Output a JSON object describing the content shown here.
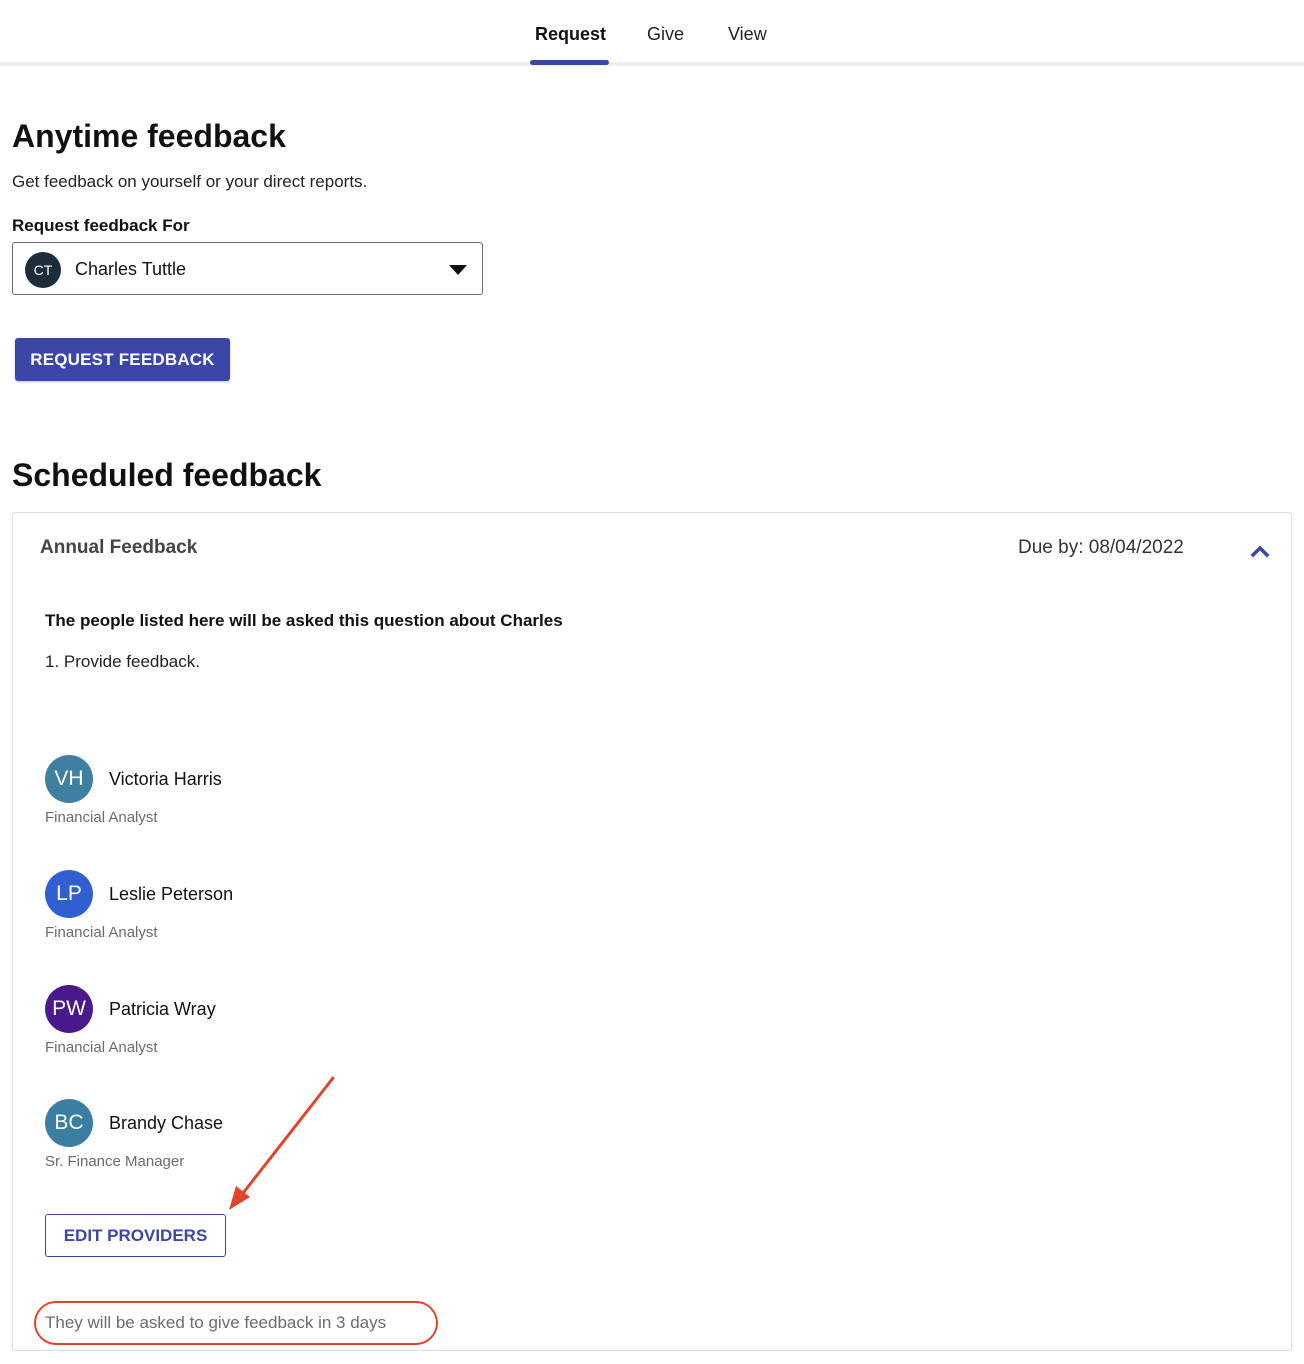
{
  "tabs": [
    {
      "label": "Request",
      "active": true
    },
    {
      "label": "Give",
      "active": false
    },
    {
      "label": "View",
      "active": false
    }
  ],
  "anytime": {
    "title": "Anytime feedback",
    "subtitle": "Get feedback on yourself or your direct reports.",
    "field_label": "Request feedback For",
    "selected_initials": "CT",
    "selected_name": "Charles Tuttle",
    "button_label": "REQUEST FEEDBACK"
  },
  "scheduled": {
    "title": "Scheduled feedback",
    "card": {
      "name": "Annual Feedback",
      "due": "Due by: 08/04/2022",
      "question_heading": "The people listed here will be asked this question about Charles",
      "question": "1. Provide feedback.",
      "providers": [
        {
          "initials": "VH",
          "name": "Victoria Harris",
          "title": "Financial Analyst",
          "color": "#3f7fa0"
        },
        {
          "initials": "LP",
          "name": "Leslie Peterson",
          "title": "Financial Analyst",
          "color": "#2f5fd0"
        },
        {
          "initials": "PW",
          "name": "Patricia Wray",
          "title": "Financial Analyst",
          "color": "#4a1a8c"
        },
        {
          "initials": "BC",
          "name": "Brandy Chase",
          "title": "Sr. Finance Manager",
          "color": "#3a7ea1"
        }
      ],
      "edit_button": "EDIT PROVIDERS",
      "note": "They will be asked to give feedback in 3 days"
    }
  },
  "colors": {
    "accent": "#3b47a6",
    "annotation": "#e0452b"
  }
}
